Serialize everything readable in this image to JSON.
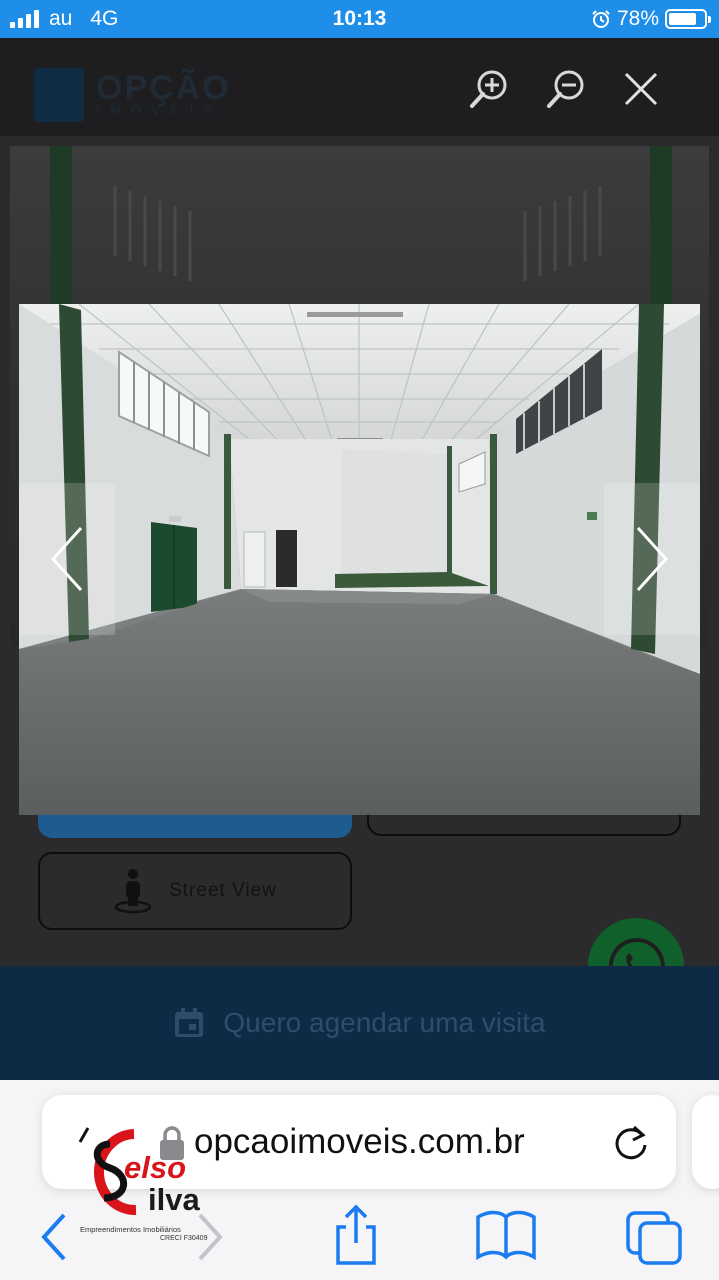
{
  "status_bar": {
    "carrier": "au",
    "network": "4G",
    "time": "10:13",
    "battery": "78%",
    "battery_level": 0.78,
    "bar_color": "#1f8ee8"
  },
  "site": {
    "logo_name": "OPÇÃO",
    "logo_sub": "IMOVEIS",
    "street_view_label": "Street View",
    "visit_label": "Quero agendar uma visita"
  },
  "viewer": {
    "icons": [
      "zoom-in-icon",
      "zoom-out-icon",
      "close-icon",
      "chevron-left-icon",
      "chevron-right-icon"
    ]
  },
  "browser": {
    "url": "opcaoimoveis.com.br",
    "accent": "#1a7cf0"
  },
  "watermark": {
    "line1": "elso",
    "line2": "ilva",
    "line3": "Empreendimentos Imobiliários",
    "line4": "CRECI F30409"
  }
}
